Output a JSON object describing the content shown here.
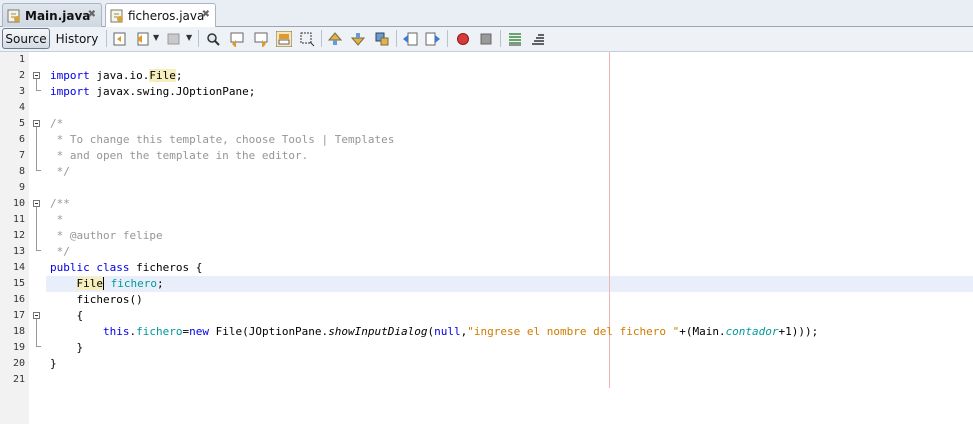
{
  "tabs": [
    {
      "label": "Main.java",
      "active": false
    },
    {
      "label": "ficheros.java",
      "active": true
    }
  ],
  "toolbar": {
    "source_label": "Source",
    "history_label": "History"
  },
  "editor": {
    "line_numbers": [
      "1",
      "2",
      "3",
      "4",
      "5",
      "6",
      "7",
      "8",
      "9",
      "10",
      "11",
      "12",
      "13",
      "14",
      "15",
      "16",
      "17",
      "18",
      "19",
      "20",
      "21"
    ],
    "code": {
      "l2_kw": "import",
      "l2_pkg": " java.io.",
      "l2_cls": "File",
      "l2_end": ";",
      "l3_kw": "import",
      "l3_rest": " javax.swing.JOptionPane;",
      "l5": "/*",
      "l6": " * To change this template, choose Tools | Templates",
      "l7": " * and open the template in the editor.",
      "l8": " */",
      "l10": "/**",
      "l11": " *",
      "l12": " * @author felipe",
      "l13": " */",
      "l14_kw": "public class",
      "l14_rest": " ficheros {",
      "l15_type": "File",
      "l15_field": " fichero",
      "l15_end": ";",
      "l16": "    ficheros()",
      "l17": "    {",
      "l18_this": "this",
      "l18_dot": ".",
      "l18_field": "fichero",
      "l18_eq": "=",
      "l18_new": "new",
      "l18_a": " File(JOptionPane.",
      "l18_method": "showInputDialog",
      "l18_b": "(",
      "l18_null": "null",
      "l18_c": ",",
      "l18_str": "\"ingrese el nombre del fichero \"",
      "l18_d": "+(Main.",
      "l18_static": "contador",
      "l18_e": "+1)));",
      "l19": "    }",
      "l20": "}"
    }
  },
  "colors": {
    "keyword": "#0000e6",
    "comment": "#969696",
    "string": "#ce7b00",
    "field": "#009999",
    "current_line": "#e9effa",
    "margin": "#f3b3b3"
  }
}
